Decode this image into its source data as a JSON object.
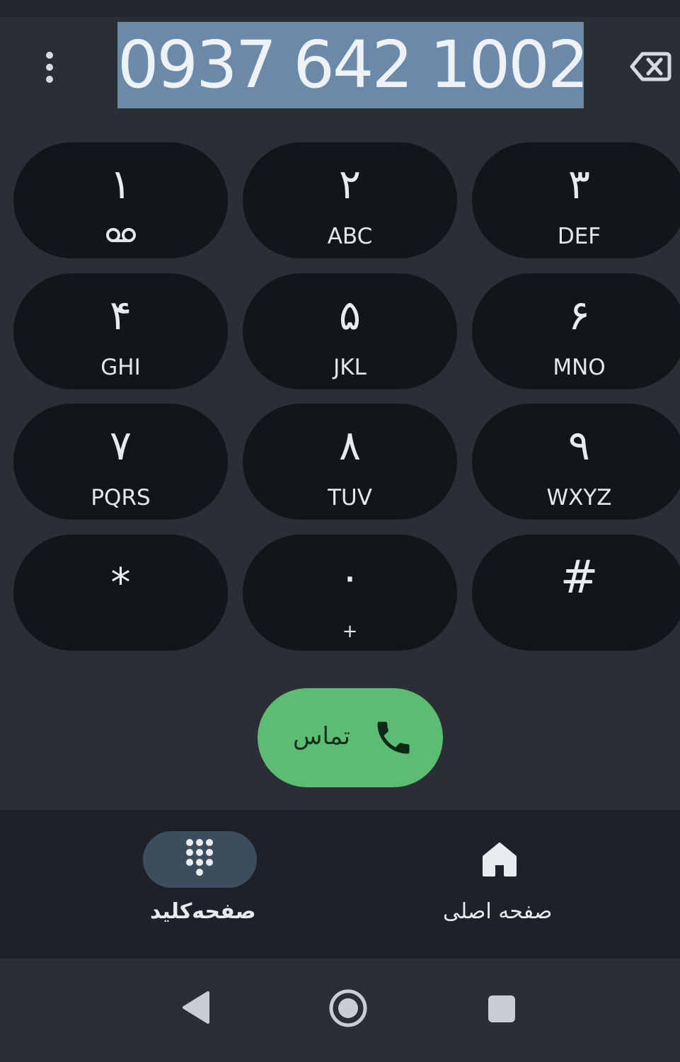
{
  "dialer": {
    "number": "0937 642 1002",
    "menu_icon": "more-vert-icon",
    "backspace_icon": "backspace-icon"
  },
  "keypad": [
    {
      "digit": "١",
      "letters": "",
      "icon": "voicemail-icon"
    },
    {
      "digit": "٢",
      "letters": "ABC"
    },
    {
      "digit": "٣",
      "letters": "DEF"
    },
    {
      "digit": "۴",
      "letters": "GHI"
    },
    {
      "digit": "۵",
      "letters": "JKL"
    },
    {
      "digit": "۶",
      "letters": "MNO"
    },
    {
      "digit": "٧",
      "letters": "PQRS"
    },
    {
      "digit": "٨",
      "letters": "TUV"
    },
    {
      "digit": "٩",
      "letters": "WXYZ"
    },
    {
      "digit": "*",
      "letters": ""
    },
    {
      "digit": "٠",
      "letters": "+"
    },
    {
      "digit": "#",
      "letters": ""
    }
  ],
  "call_button": {
    "label": "تماس",
    "icon": "phone-icon"
  },
  "bottom_nav": {
    "keypad_tab": {
      "label": "صفحه‌کلید",
      "icon": "dialpad-icon",
      "selected": true
    },
    "home_tab": {
      "label": "صفحه اصلی",
      "icon": "home-icon",
      "selected": false
    }
  },
  "system_nav": {
    "back_icon": "back-triangle-icon",
    "home_icon": "home-circle-icon",
    "recents_icon": "recents-square-icon"
  },
  "colors": {
    "accent_green": "#5cbd72",
    "key_bg": "#12161b",
    "selection": "#6b8aa9",
    "nav_pill": "#3c4d5e"
  }
}
